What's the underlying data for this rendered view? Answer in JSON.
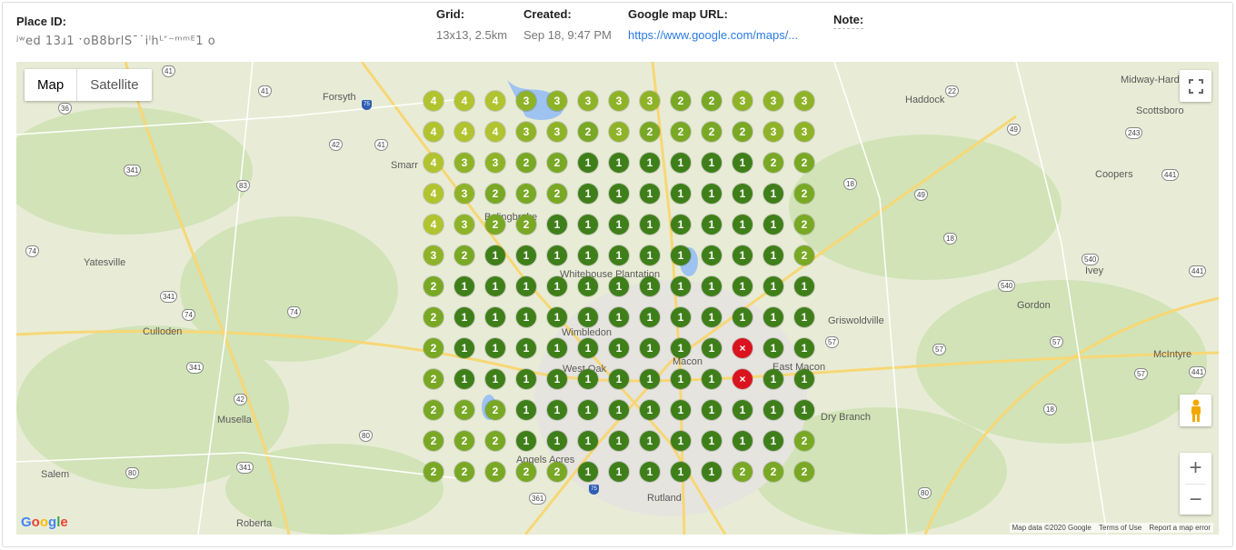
{
  "header": {
    "place_id_label": "Place ID:",
    "place_id_value": "ʲʷed 13ɹ1 ˑoB8brlSˉ˙iˡhᴸ˹⁻ᵐᵐᴱ1 o",
    "grid_label": "Grid:",
    "grid_value": "13x13, 2.5km",
    "created_label": "Created:",
    "created_value": "Sep 18, 9:47 PM",
    "url_label": "Google map URL:",
    "url_value": "https://www.google.com/maps/...",
    "note_label": "Note:"
  },
  "map": {
    "type_map": "Map",
    "type_satellite": "Satellite",
    "zoom_in": "+",
    "zoom_out": "−",
    "fullscreen_icon": "fullscreen-icon",
    "pegman_icon": "pegman-icon",
    "google_logo": "Google",
    "copyright": "Map data ©2020 Google",
    "terms": "Terms of Use",
    "report": "Report a map error",
    "places": [
      {
        "name": "Forsyth"
      },
      {
        "name": "Haddock"
      },
      {
        "name": "Midway-Hardwick"
      },
      {
        "name": "Scottsboro"
      },
      {
        "name": "Smarr"
      },
      {
        "name": "Coopers"
      },
      {
        "name": "Yatesville"
      },
      {
        "name": "Ivey"
      },
      {
        "name": "Gordon"
      },
      {
        "name": "Culloden"
      },
      {
        "name": "Griswoldville"
      },
      {
        "name": "McIntyre"
      },
      {
        "name": "Wimbledon"
      },
      {
        "name": "Macon"
      },
      {
        "name": "East Macon"
      },
      {
        "name": "West Oak"
      },
      {
        "name": "Musella"
      },
      {
        "name": "Dry Branch"
      },
      {
        "name": "Angels Acres"
      },
      {
        "name": "Salem"
      },
      {
        "name": "Rutland"
      },
      {
        "name": "Roberta"
      },
      {
        "name": "Bolingbroke"
      },
      {
        "name": "Whitehouse Plantation"
      }
    ],
    "colors": {
      "rank1": "#3f7f1a",
      "rank2": "#79a825",
      "rank3": "#8fb328",
      "rank4": "#b1c32e",
      "miss": "#d9141e"
    }
  },
  "grid": {
    "rows": [
      [
        "4",
        "4",
        "4",
        "3",
        "3",
        "3",
        "3",
        "3",
        "2",
        "2",
        "3",
        "3",
        "3"
      ],
      [
        "4",
        "4",
        "4",
        "3",
        "3",
        "2",
        "3",
        "2",
        "2",
        "2",
        "2",
        "3",
        "3"
      ],
      [
        "4",
        "3",
        "3",
        "2",
        "2",
        "1",
        "1",
        "1",
        "1",
        "1",
        "1",
        "2",
        "2"
      ],
      [
        "4",
        "3",
        "2",
        "2",
        "2",
        "1",
        "1",
        "1",
        "1",
        "1",
        "1",
        "1",
        "2"
      ],
      [
        "4",
        "3",
        "2",
        "2",
        "1",
        "1",
        "1",
        "1",
        "1",
        "1",
        "1",
        "1",
        "2"
      ],
      [
        "3",
        "2",
        "1",
        "1",
        "1",
        "1",
        "1",
        "1",
        "1",
        "1",
        "1",
        "1",
        "2"
      ],
      [
        "2",
        "1",
        "1",
        "1",
        "1",
        "1",
        "1",
        "1",
        "1",
        "1",
        "1",
        "1",
        "1"
      ],
      [
        "2",
        "1",
        "1",
        "1",
        "1",
        "1",
        "1",
        "1",
        "1",
        "1",
        "1",
        "1",
        "1"
      ],
      [
        "2",
        "1",
        "1",
        "1",
        "1",
        "1",
        "1",
        "1",
        "1",
        "1",
        "×",
        "1",
        "1"
      ],
      [
        "2",
        "1",
        "1",
        "1",
        "1",
        "1",
        "1",
        "1",
        "1",
        "1",
        "×",
        "1",
        "1"
      ],
      [
        "2",
        "2",
        "2",
        "1",
        "1",
        "1",
        "1",
        "1",
        "1",
        "1",
        "1",
        "1",
        "1"
      ],
      [
        "2",
        "2",
        "2",
        "1",
        "1",
        "1",
        "1",
        "1",
        "1",
        "1",
        "1",
        "1",
        "2"
      ],
      [
        "2",
        "2",
        "2",
        "2",
        "2",
        "1",
        "1",
        "1",
        "1",
        "1",
        "2",
        "2",
        "2"
      ]
    ]
  }
}
